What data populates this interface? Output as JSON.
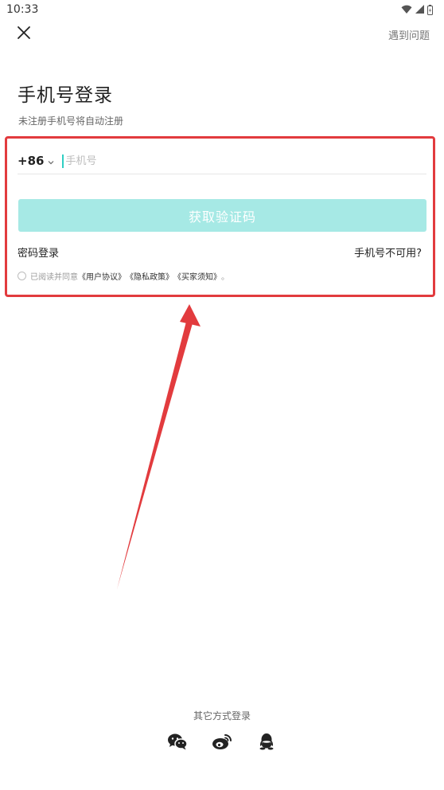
{
  "status_bar": {
    "time": "10:33",
    "icons": [
      "wifi-icon",
      "signal-icon",
      "battery-icon"
    ]
  },
  "header": {
    "close_icon": "close-icon",
    "help_label": "遇到问题"
  },
  "login": {
    "title": "手机号登录",
    "subtitle": "未注册手机号将自动注册",
    "country_code": "+86",
    "phone_placeholder": "手机号",
    "phone_value": "",
    "get_code_label": "获取验证码",
    "password_login_label": "密码登录",
    "phone_unavailable_label": "手机号不可用?",
    "agreement": {
      "prefix": "已阅读并同意",
      "user_agreement": "《用户协议》",
      "privacy_policy": "《隐私政策》",
      "buyer_notice": "《买家须知》",
      "suffix": "。"
    }
  },
  "other_login": {
    "label": "其它方式登录",
    "methods": [
      "wechat-icon",
      "weibo-icon",
      "qq-icon"
    ]
  },
  "colors": {
    "accent": "#2fcfc3",
    "button_disabled": "#a6e9e5",
    "annotation": "#e23b3e"
  }
}
